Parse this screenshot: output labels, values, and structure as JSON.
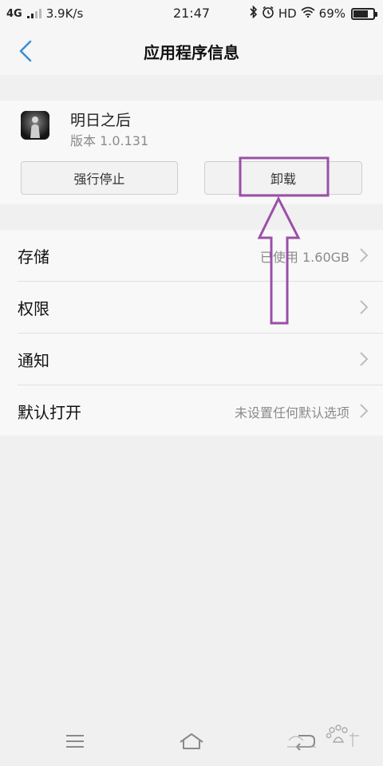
{
  "status_bar": {
    "network": "4G",
    "speed": "3.9K/s",
    "time": "21:47",
    "hd": "HD",
    "battery_text": "69%",
    "battery_level": 0.69
  },
  "header": {
    "title": "应用程序信息"
  },
  "app": {
    "name": "明日之后",
    "version": "版本 1.0.131",
    "force_stop_label": "强行停止",
    "uninstall_label": "卸载"
  },
  "settings": [
    {
      "label": "存储",
      "value": "已使用 1.60GB"
    },
    {
      "label": "权限",
      "value": ""
    },
    {
      "label": "通知",
      "value": ""
    },
    {
      "label": "默认打开",
      "value": "未设置任何默认选项"
    }
  ],
  "annotation": {
    "color": "#9b4fa8"
  },
  "colors": {
    "accent": "#3a8fd6",
    "background": "#f0f0f0"
  },
  "icons": {
    "back": "chevron-left-icon",
    "menu": "menu-icon",
    "home": "home-icon",
    "return": "return-icon"
  }
}
